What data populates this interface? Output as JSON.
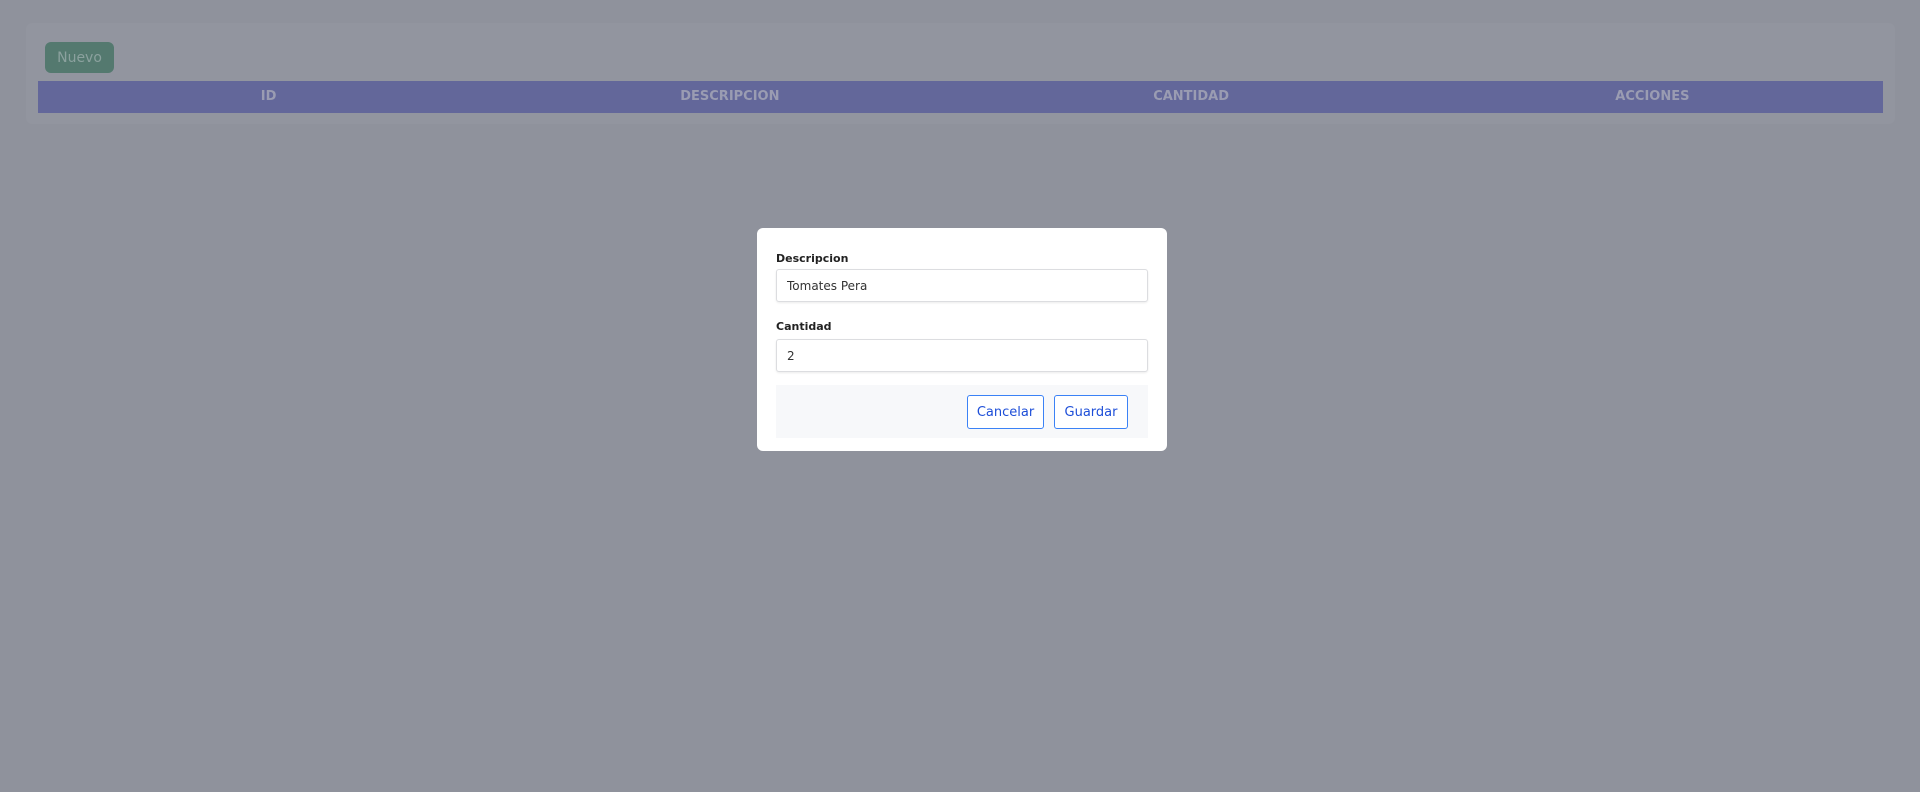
{
  "toolbar": {
    "new_label": "Nuevo"
  },
  "table": {
    "columns": [
      "ID",
      "DESCRIPCION",
      "CANTIDAD",
      "ACCIONES"
    ]
  },
  "modal": {
    "descripcion_label": "Descripcion",
    "descripcion_value": "Tomates Pera",
    "cantidad_label": "Cantidad",
    "cantidad_value": "2",
    "cancel_label": "Cancelar",
    "save_label": "Guardar"
  }
}
